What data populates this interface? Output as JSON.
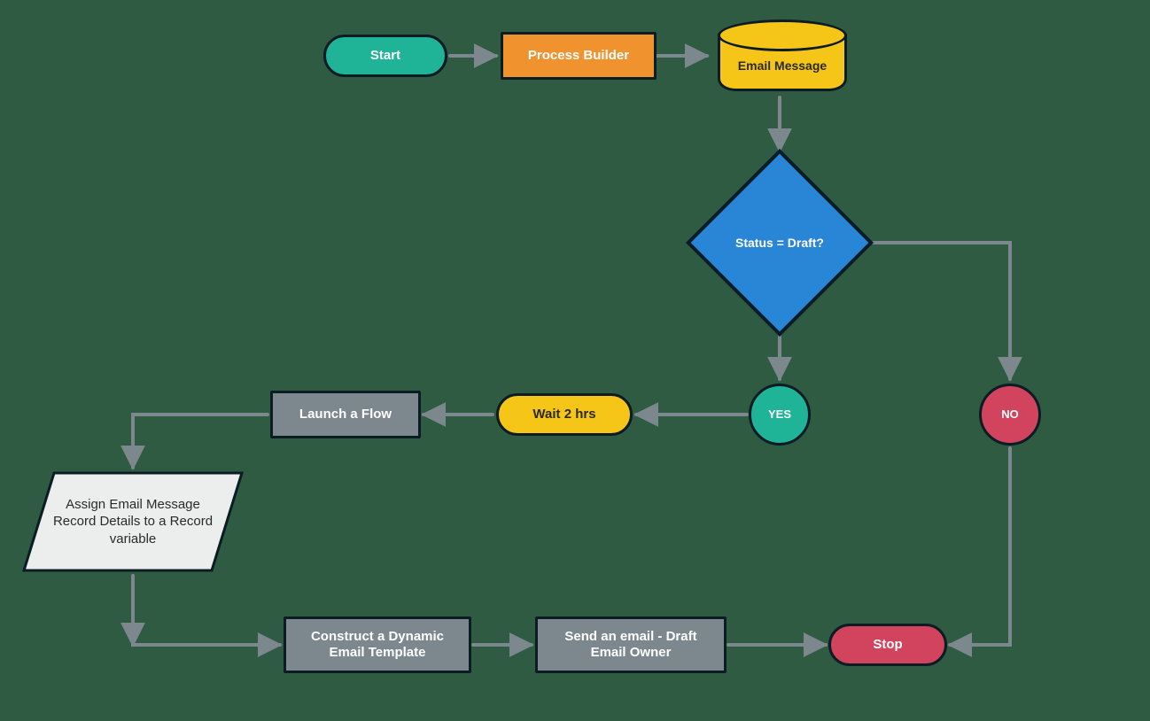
{
  "nodes": {
    "start": "Start",
    "process_builder": "Process Builder",
    "email_message": "Email Message",
    "decision": "Status = Draft?",
    "yes": "YES",
    "no": "NO",
    "wait": "Wait 2 hrs",
    "launch_flow": "Launch a Flow",
    "assign": "Assign Email Message Record Details to a Record variable",
    "construct": "Construct a Dynamic Email Template",
    "send": "Send an email - Draft Email Owner",
    "stop": "Stop"
  },
  "colors": {
    "teal": "#1fb398",
    "orange": "#f0932e",
    "yellow": "#f5c518",
    "gray": "#7c878e",
    "blue": "#2986d6",
    "red": "#d2445e",
    "light": "#eceeee",
    "arrow": "#7c878e"
  }
}
